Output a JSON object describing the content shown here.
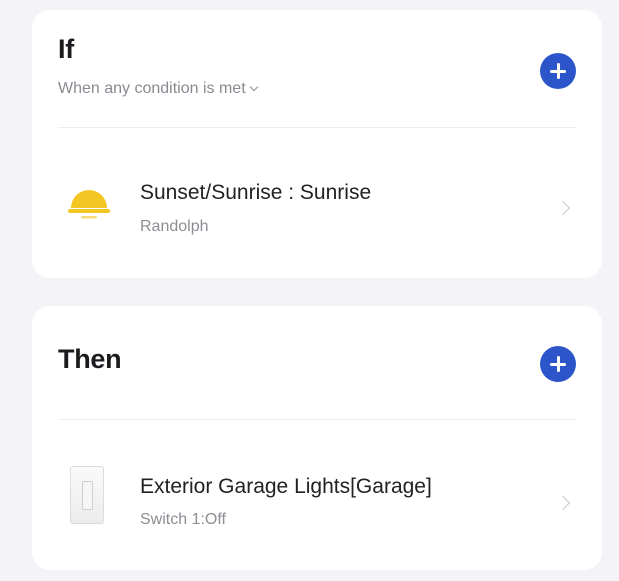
{
  "if_section": {
    "title": "If",
    "condition_mode": "When any condition is met",
    "conditions": [
      {
        "title": "Sunset/Sunrise : Sunrise",
        "subtitle": "Randolph",
        "icon": "sunrise-icon",
        "icon_color": "#f3c623"
      }
    ]
  },
  "then_section": {
    "title": "Then",
    "actions": [
      {
        "title": "Exterior Garage Lights[Garage]",
        "subtitle": "Switch 1:Off",
        "icon": "light-switch-icon"
      }
    ]
  },
  "colors": {
    "accent": "#2b55c9",
    "background": "#f4f4f8",
    "card": "#ffffff"
  }
}
